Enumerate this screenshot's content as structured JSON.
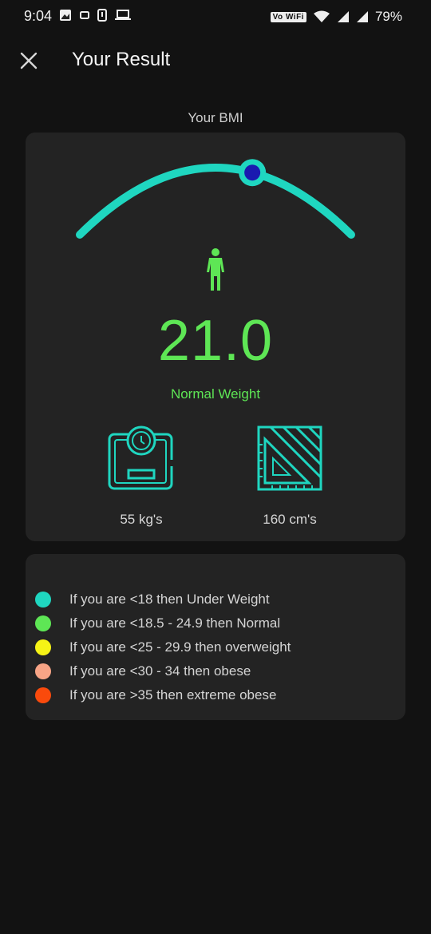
{
  "status_bar": {
    "time": "9:04",
    "network_badge": "Vo WiFi",
    "battery": "79%"
  },
  "header": {
    "title": "Your Result",
    "close_icon": "close-icon"
  },
  "result": {
    "section_label": "Your BMI",
    "bmi_value": "21.0",
    "category": "Normal Weight",
    "gauge_position_fraction": 0.62,
    "weight_label": "55 kg's",
    "height_label": "160 cm's"
  },
  "legend": {
    "items": [
      {
        "text": "If you are <18 then Under Weight",
        "color": "#1fd6c0"
      },
      {
        "text": "If you are <18.5 - 24.9 then Normal",
        "color": "#5ee655"
      },
      {
        "text": "If you are <25 - 29.9 then overweight",
        "color": "#f6f316"
      },
      {
        "text": "If you are <30 - 34 then obese",
        "color": "#f7a486"
      },
      {
        "text": "If you are >35 then extreme obese",
        "color": "#fa4a0c"
      }
    ]
  },
  "colors": {
    "accent": "#1fd6c0",
    "normal": "#5ee655",
    "indicator": "#1a1ab0",
    "background": "#121212",
    "card": "#232323"
  }
}
